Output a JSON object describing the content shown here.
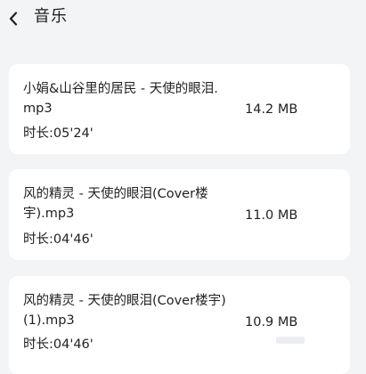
{
  "header": {
    "title": "音乐",
    "back_icon": "chevron-left-icon"
  },
  "files": [
    {
      "name": "小娟&山谷里的居民 - 天使的眼泪.mp3",
      "duration": "时长:05'24'",
      "size": "14.2 MB"
    },
    {
      "name": "风的精灵 - 天使的眼泪(Cover楼宇).mp3",
      "duration": "时长:04'46'",
      "size": "11.0 MB"
    },
    {
      "name": "风的精灵 - 天使的眼泪(Cover楼宇)(1).mp3",
      "duration": "时长:04'46'",
      "size": "10.9 MB"
    }
  ],
  "colors": {
    "background": "#f3f4f6",
    "card": "#ffffff",
    "text": "#222222"
  }
}
